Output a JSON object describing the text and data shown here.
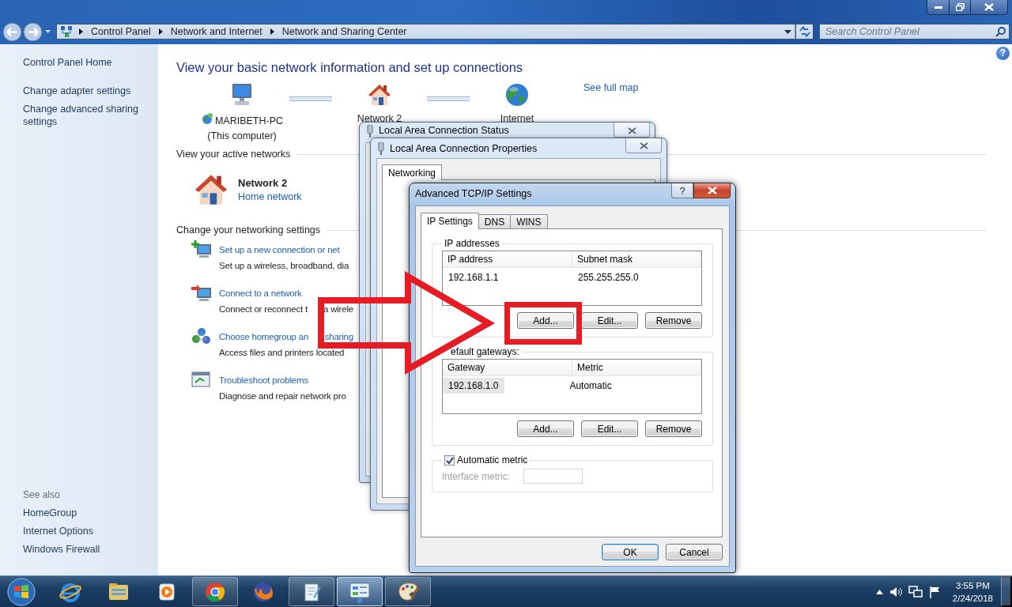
{
  "address_bar": {
    "breadcrumb": [
      "Control Panel",
      "Network and Internet",
      "Network and Sharing Center"
    ]
  },
  "search": {
    "placeholder": "Search Control Panel"
  },
  "help_button": "?",
  "sidebar": {
    "links": [
      "Control Panel Home",
      "Change adapter settings",
      "Change advanced sharing settings"
    ],
    "see_also": {
      "heading": "See also",
      "links": [
        "HomeGroup",
        "Internet Options",
        "Windows Firewall"
      ]
    }
  },
  "main": {
    "heading": "View your basic network information and set up connections",
    "map": {
      "nodes": [
        {
          "kind": "computer",
          "name": "MARIBETH-PC",
          "note": "(This computer)"
        },
        {
          "kind": "network",
          "name": "Network  2"
        },
        {
          "kind": "internet",
          "name": "Internet"
        }
      ],
      "link": "See full map"
    },
    "active_networks": {
      "heading": "View your active networks",
      "name": "Network  2",
      "type": "Home network"
    },
    "settings": {
      "heading": "Change your networking settings",
      "tasks": [
        {
          "kind": "new-connection",
          "title": "Set up a new connection or net",
          "description": "Set up a wireless, broadband, dia"
        },
        {
          "kind": "connect",
          "title": "Connect to a network",
          "description": "Connect or reconnect t",
          "description_tail": "a wirele"
        },
        {
          "kind": "homegroup",
          "title": "Choose homegroup an",
          "title_tail": "sharing",
          "description": "Access files and printers located"
        },
        {
          "kind": "troubleshoot",
          "title": "Troubleshoot problems",
          "description": "Diagnose and repair network pro"
        }
      ]
    }
  },
  "status_window": {
    "title": "Local Area Connection Status"
  },
  "properties_window": {
    "title": "Local Area Connection Properties",
    "tabs": [
      {
        "label": "Networking",
        "selected": true
      }
    ]
  },
  "dialog": {
    "title": "Advanced TCP/IP Settings",
    "help": "?",
    "tabs": [
      {
        "label": "IP Settings",
        "selected": true
      },
      {
        "label": "DNS",
        "selected": false
      },
      {
        "label": "WINS",
        "selected": false
      }
    ],
    "ip_addresses": {
      "label": "IP addresses",
      "columns": [
        "IP address",
        "Subnet mask"
      ],
      "rows": [
        {
          "cells": [
            "192.168.1.1",
            "255.255.255.0"
          ],
          "selected": false
        }
      ],
      "buttons": [
        "Add...",
        "Edit...",
        "Remove"
      ]
    },
    "gateways": {
      "label": "efault gateways:",
      "columns": [
        "Gateway",
        "Metric"
      ],
      "rows": [
        {
          "cells": [
            "192.168.1.0",
            "Automatic"
          ],
          "selected": true
        }
      ],
      "buttons": [
        "Add...",
        "Edit...",
        "Remove"
      ]
    },
    "automatic_metric": {
      "label": "Automatic metric",
      "checked": true
    },
    "interface_metric": {
      "label": "Interface metric:",
      "disabled": true
    },
    "buttons": [
      "OK",
      "Cancel"
    ]
  },
  "taskbar": {
    "apps": [
      {
        "kind": "ie",
        "running": false,
        "active": false
      },
      {
        "kind": "explorer",
        "running": false,
        "active": false
      },
      {
        "kind": "media",
        "running": false,
        "active": false
      },
      {
        "kind": "chrome",
        "running": true,
        "active": false
      },
      {
        "kind": "firefox",
        "running": false,
        "active": false
      },
      {
        "kind": "notes",
        "running": true,
        "active": false
      },
      {
        "kind": "control-panel",
        "running": true,
        "active": true
      },
      {
        "kind": "paint",
        "running": true,
        "active": false
      }
    ],
    "clock": {
      "time": "3:55 PM",
      "date": "2/24/2018"
    }
  }
}
